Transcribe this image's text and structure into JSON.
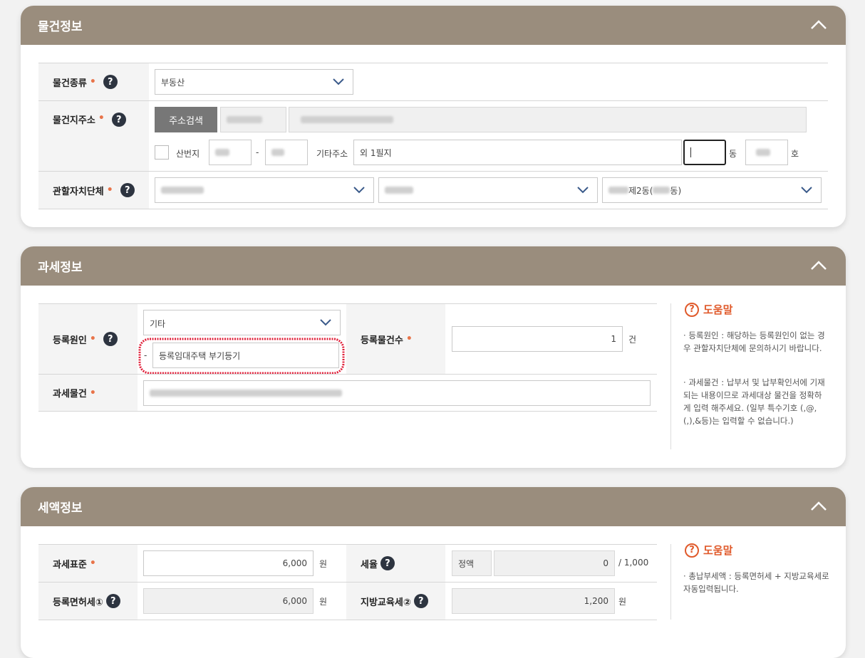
{
  "sec1": {
    "title": "물건정보",
    "kind_label": "물건종류",
    "kind_value": "부동산",
    "addr_label": "물건지주소",
    "addr_btn": "주소검색",
    "sanbun_label": "산번지",
    "dash": "-",
    "etc_label": "기타주소",
    "etc_value": "외 1필지",
    "dong_unit": "동",
    "ho_unit": "호",
    "gov_label": "관할자치단체",
    "gov3_value": "제2동(",
    "gov3_suffix": "동)"
  },
  "sec2": {
    "title": "과세정보",
    "reason_label": "등록원인",
    "reason_value": "기타",
    "reason_detail_dash": "-",
    "reason_detail_value": "등록임대주택 부기등기",
    "count_label": "등록물건수",
    "count_value": "1",
    "count_unit": "건",
    "object_label": "과세물건",
    "help_title": "도움말",
    "help_1": "등록원인 : 해당하는 등록원인이 없는 경우 관할자치단체에 문의하시기 바랍니다.",
    "help_2": "과세물건 : 납부서 및 납부확인서에 기재되는 내용이므로 과세대상 물건을 정확하게 입력 해주세요. (일부 특수기호 (,@,(,),&등)는 입력할 수 없습니다.)"
  },
  "sec3": {
    "title": "세액정보",
    "base_label": "과세표준",
    "base_value": "6,000",
    "won": "원",
    "rate_label": "세율",
    "rate_type": "정액",
    "rate_value": "0",
    "rate_unit": "/ 1,000",
    "reg_tax_label": "등록면허세①",
    "reg_tax_value": "6,000",
    "edu_tax_label": "지방교육세②",
    "edu_tax_value": "1,200",
    "help_title": "도움말",
    "help_1": "총납부세액 : 등록면허세 + 지방교육세로 자동입력됩니다."
  },
  "icons": {
    "question": "?",
    "help": "?"
  },
  "colors": {
    "header": "#9a8d7d",
    "accent": "#e05a2b",
    "required": "#e8744a"
  }
}
